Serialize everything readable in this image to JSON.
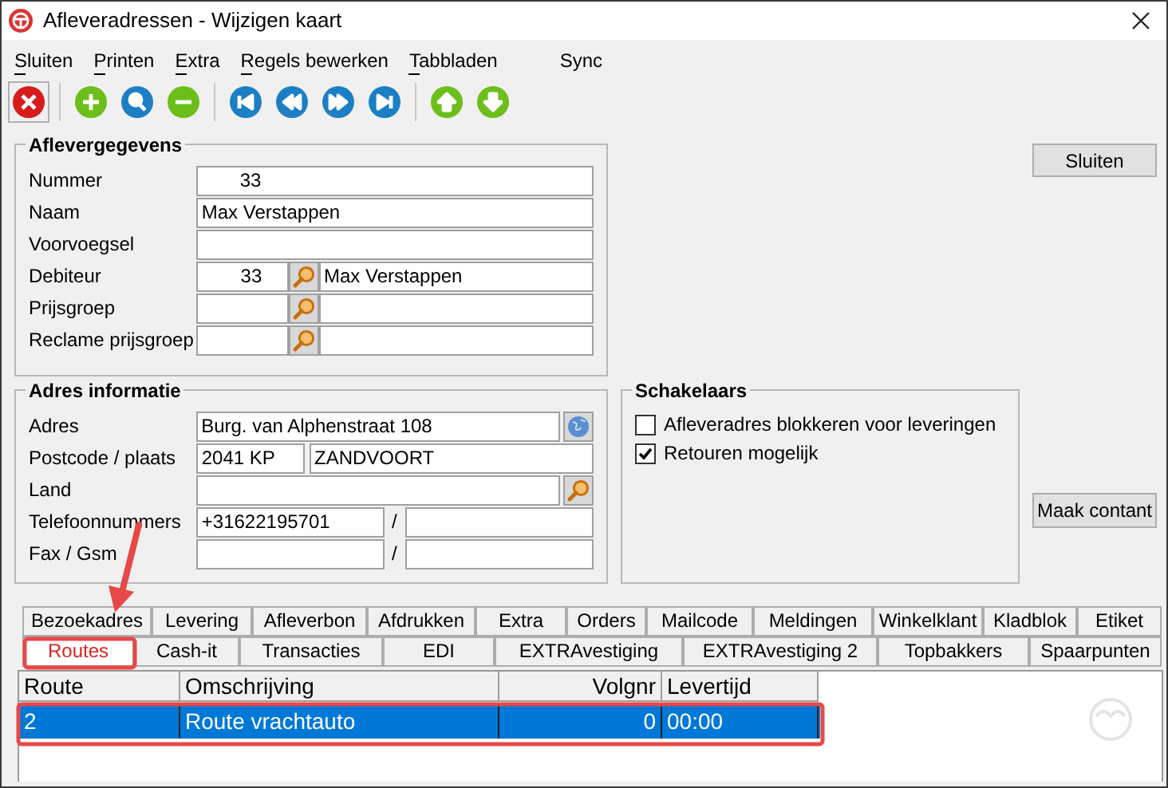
{
  "window": {
    "title": "Afleveradressen - Wijzigen kaart"
  },
  "menu": [
    {
      "label": "Sluiten",
      "underlined": true
    },
    {
      "label": "Printen",
      "underlined": true
    },
    {
      "label": "Extra",
      "underlined": true
    },
    {
      "label": "Regels bewerken",
      "underlined": true
    },
    {
      "label": "Tabbladen",
      "underlined": true
    },
    {
      "label": "Sync",
      "underlined": false
    }
  ],
  "toolbar": [
    {
      "kind": "close"
    },
    {
      "kind": "sep"
    },
    {
      "kind": "add"
    },
    {
      "kind": "search"
    },
    {
      "kind": "remove"
    },
    {
      "kind": "sep"
    },
    {
      "kind": "first"
    },
    {
      "kind": "prev"
    },
    {
      "kind": "next"
    },
    {
      "kind": "last"
    },
    {
      "kind": "sep"
    },
    {
      "kind": "up"
    },
    {
      "kind": "down"
    }
  ],
  "aflevergegevens": {
    "title": "Aflevergegevens",
    "fields": [
      {
        "kind": "number",
        "label": "Nummer",
        "value": "33"
      },
      {
        "kind": "text",
        "label": "Naam",
        "value": "Max Verstappen"
      },
      {
        "kind": "text",
        "label": "Voorvoegsel"
      },
      {
        "kind": "lookup",
        "label": "Debiteur",
        "value": "33",
        "display": "Max Verstappen"
      },
      {
        "kind": "lookup",
        "label": "Prijsgroep"
      },
      {
        "kind": "lookup",
        "label": "Reclame prijsgroep"
      }
    ]
  },
  "adres": {
    "title": "Adres informatie",
    "fields": [
      {
        "kind": "globe",
        "label": "Adres",
        "value": "Burg. van Alphenstraat 108"
      },
      {
        "kind": "pair",
        "label": "Postcode / plaats",
        "value": "2041 KP",
        "value2": "ZANDVOORT"
      },
      {
        "kind": "search",
        "label": "Land"
      },
      {
        "kind": "slash",
        "label": "Telefoonnummers",
        "value": "+31622195701",
        "separator": "/"
      },
      {
        "kind": "slash",
        "label": "Fax / Gsm",
        "separator": "/"
      }
    ]
  },
  "schakelaars": {
    "title": "Schakelaars",
    "options": [
      {
        "label": "Afleveradres blokkeren voor leveringen",
        "checked": false
      },
      {
        "label": "Retouren mogelijk",
        "checked": true
      }
    ]
  },
  "buttons": {
    "close": "Sluiten",
    "cash": "Maak contant"
  },
  "tab_rows": [
    [
      {
        "label": "Bezoekadres",
        "selected": false
      },
      {
        "label": "Levering",
        "selected": false
      },
      {
        "label": "Afleverbon",
        "selected": false
      },
      {
        "label": "Afdrukken",
        "selected": false
      },
      {
        "label": "Extra",
        "selected": false
      },
      {
        "label": "Orders",
        "selected": false
      },
      {
        "label": "Mailcode",
        "selected": false
      },
      {
        "label": "Meldingen",
        "selected": false
      },
      {
        "label": "Winkelklant",
        "selected": false
      },
      {
        "label": "Kladblok",
        "selected": false
      },
      {
        "label": "Etiket",
        "selected": false
      }
    ],
    [
      {
        "label": "Routes",
        "selected": true
      },
      {
        "label": "Cash-it",
        "selected": false
      },
      {
        "label": "Transacties",
        "selected": false
      },
      {
        "label": "EDI",
        "selected": false
      },
      {
        "label": "EXTRAvestiging",
        "selected": false
      },
      {
        "label": "EXTRAvestiging 2",
        "selected": false
      },
      {
        "label": "Topbakkers",
        "selected": false
      },
      {
        "label": "Spaarpunten",
        "selected": false
      }
    ]
  ],
  "table": {
    "columns": [
      "Route",
      "Omschrijving",
      "Volgnr",
      "Levertijd"
    ],
    "rows": [
      {
        "cells": [
          "2",
          "Route vrachtauto",
          "0",
          "00:00"
        ],
        "selected": true
      }
    ]
  }
}
